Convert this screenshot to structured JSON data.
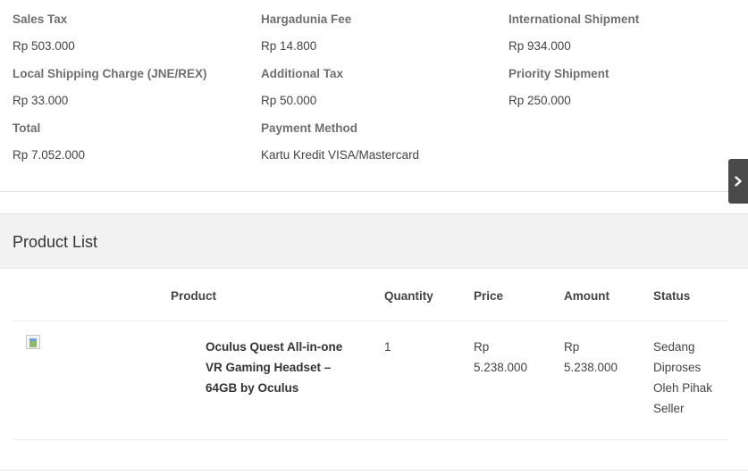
{
  "summary": {
    "sales_tax_label": "Sales Tax",
    "sales_tax_value": "Rp 503.000",
    "hargadunia_fee_label": "Hargadunia Fee",
    "hargadunia_fee_value": "Rp 14.800",
    "international_shipment_label": "International Shipment",
    "international_shipment_value": "Rp 934.000",
    "local_shipping_label": "Local Shipping Charge (JNE/REX)",
    "local_shipping_value": "Rp 33.000",
    "additional_tax_label": "Additional Tax",
    "additional_tax_value": "Rp 50.000",
    "priority_shipment_label": "Priority Shipment",
    "priority_shipment_value": "Rp 250.000",
    "total_label": "Total",
    "total_value": "Rp 7.052.000",
    "payment_method_label": "Payment Method",
    "payment_method_value": "Kartu Kredit VISA/Mastercard"
  },
  "side_toggle": {
    "icon": "chevron-right-icon"
  },
  "product_list": {
    "title": "Product List",
    "headers": {
      "product": "Product",
      "quantity": "Quantity",
      "price": "Price",
      "amount": "Amount",
      "status": "Status"
    },
    "items": [
      {
        "image_icon": "broken-image-icon",
        "name": "Oculus Quest All-in-one VR Gaming Headset – 64GB by Oculus",
        "quantity": "1",
        "price": "Rp 5.238.000",
        "amount": "Rp 5.238.000",
        "status": "Sedang Diproses Oleh Pihak Seller"
      }
    ]
  }
}
